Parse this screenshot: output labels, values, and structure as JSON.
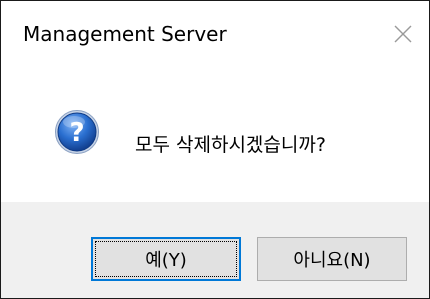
{
  "dialog": {
    "title": "Management Server",
    "close_icon": "close-icon",
    "icon": "question-icon",
    "message": "모두 삭제하시겠습니까?",
    "buttons": {
      "yes_label": "예(Y)",
      "no_label": "아니요(N)"
    },
    "colors": {
      "footer_bg": "#f0f0f0",
      "button_bg": "#e1e1e1",
      "default_button_border": "#0078d7",
      "icon_blue": "#1f5fbf"
    }
  }
}
